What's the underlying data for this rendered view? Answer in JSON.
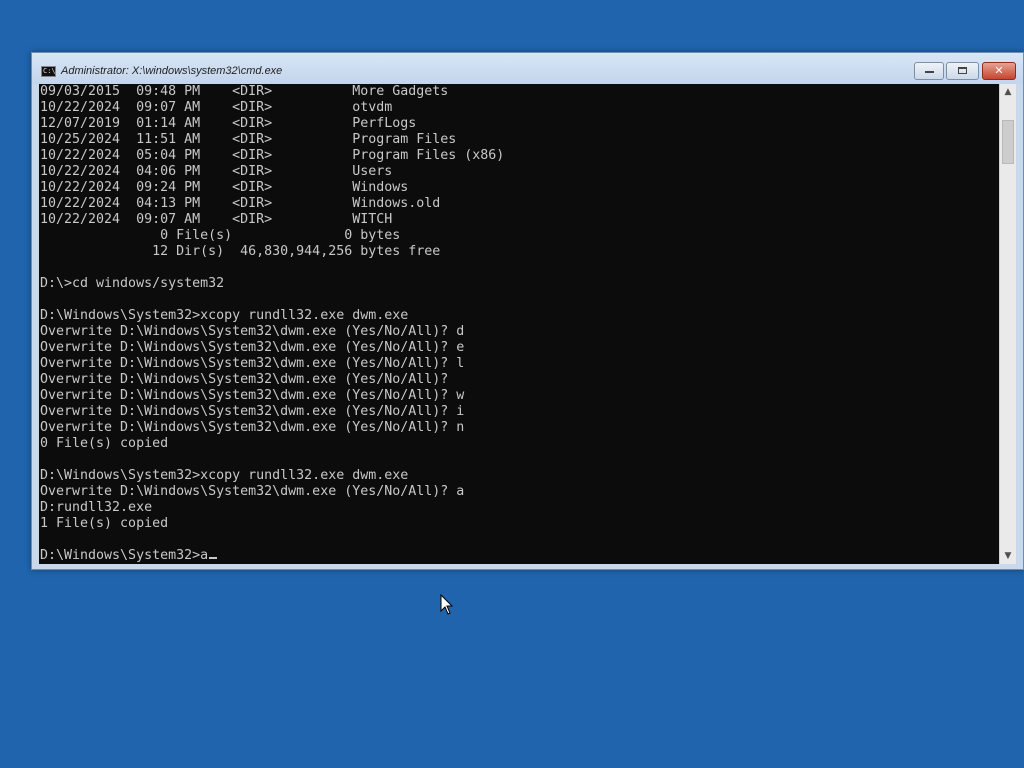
{
  "window": {
    "title": "Administrator: X:\\windows\\system32\\cmd.exe",
    "app_icon_glyph": "C:\\",
    "minimize_label": "minimize",
    "maximize_label": "maximize",
    "close_label": "✕"
  },
  "console": {
    "text": "09/03/2015  09:48 PM    <DIR>          More Gadgets\n10/22/2024  09:07 AM    <DIR>          otvdm\n12/07/2019  01:14 AM    <DIR>          PerfLogs\n10/25/2024  11:51 AM    <DIR>          Program Files\n10/22/2024  05:04 PM    <DIR>          Program Files (x86)\n10/22/2024  04:06 PM    <DIR>          Users\n10/22/2024  09:24 PM    <DIR>          Windows\n10/22/2024  04:13 PM    <DIR>          Windows.old\n10/22/2024  09:07 AM    <DIR>          WITCH\n               0 File(s)              0 bytes\n              12 Dir(s)  46,830,944,256 bytes free\n\nD:\\>cd windows/system32\n\nD:\\Windows\\System32>xcopy rundll32.exe dwm.exe\nOverwrite D:\\Windows\\System32\\dwm.exe (Yes/No/All)? d\nOverwrite D:\\Windows\\System32\\dwm.exe (Yes/No/All)? e\nOverwrite D:\\Windows\\System32\\dwm.exe (Yes/No/All)? l\nOverwrite D:\\Windows\\System32\\dwm.exe (Yes/No/All)?\nOverwrite D:\\Windows\\System32\\dwm.exe (Yes/No/All)? w\nOverwrite D:\\Windows\\System32\\dwm.exe (Yes/No/All)? i\nOverwrite D:\\Windows\\System32\\dwm.exe (Yes/No/All)? n\n0 File(s) copied\n\nD:\\Windows\\System32>xcopy rundll32.exe dwm.exe\nOverwrite D:\\Windows\\System32\\dwm.exe (Yes/No/All)? a\nD:rundll32.exe\n1 File(s) copied\n\nD:\\Windows\\System32>a"
  },
  "icons": {
    "app": "cmd-icon",
    "minimize": "minimize-icon",
    "maximize": "maximize-icon",
    "close": "close-icon",
    "scroll_up": "scroll-up-icon",
    "scroll_down": "scroll-down-icon",
    "pointer": "mouse-pointer-icon"
  },
  "colors": {
    "desktop": "#1f64ad",
    "console_bg": "#0c0c0c",
    "console_fg": "#c8c8c8",
    "close_button": "#c8442d"
  }
}
